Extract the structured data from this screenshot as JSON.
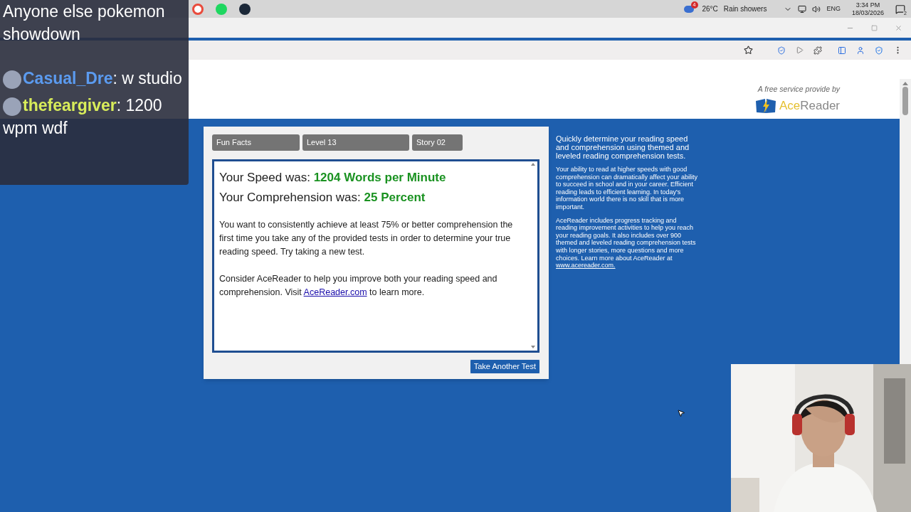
{
  "taskbar": {
    "weather_badge": "4",
    "temperature": "26°C",
    "weather": "Rain showers",
    "language": "ENG",
    "time": "3:34 PM",
    "date": "18/03/2026",
    "notification_count": "2"
  },
  "page": {
    "provider_caption": "A free service provide by",
    "logo": {
      "first": "Ace",
      "second": "Reader"
    },
    "test_tags": [
      "Fun Facts",
      "Level 13",
      "Story 02"
    ],
    "results": [
      {
        "label": "Your Speed was:",
        "value": "1204 Words per Minute"
      },
      {
        "label": "Your Comprehension was:",
        "value": "25 Percent"
      }
    ],
    "advice": "You want to consistently achieve at least 75% or better comprehension the first time you take any of the provided tests in order to determine your true reading speed. Try taking a new test.",
    "promo": {
      "before": "Consider AceReader to help you improve both your reading speed and comprehension. Visit",
      "link": "AceReader.com",
      "after": "to learn more."
    },
    "action": "Take Another Test",
    "sidebar": {
      "intro": "Quickly determine your reading speed and comprehension using themed and leveled reading comprehension tests.",
      "body": "Your ability to read at higher speeds with good comprehension can dramatically affect your ability to succeed in school and in your career. Efficient reading leads to efficient learning. In today's information world there is no skill that is more important.",
      "more": "AceReader includes progress tracking and reading improvement activities to help you reach your reading goals. It also includes over 900 themed and leveled reading comprehension tests with longer stories, more questions and more choices. Learn more about AceReader at",
      "link": "www.acereader.com."
    }
  },
  "chat": [
    {
      "color": "#ffffff",
      "text": "Anyone else pokemon showdown"
    },
    {
      "user": "Casual_Dre",
      "separator": ":",
      "color": "#5b9bf0",
      "text": "w studio"
    },
    {
      "user": "thefeargiver",
      "separator": ":",
      "color": "#d8ec5a",
      "text": "1200 wpm wdf"
    }
  ]
}
